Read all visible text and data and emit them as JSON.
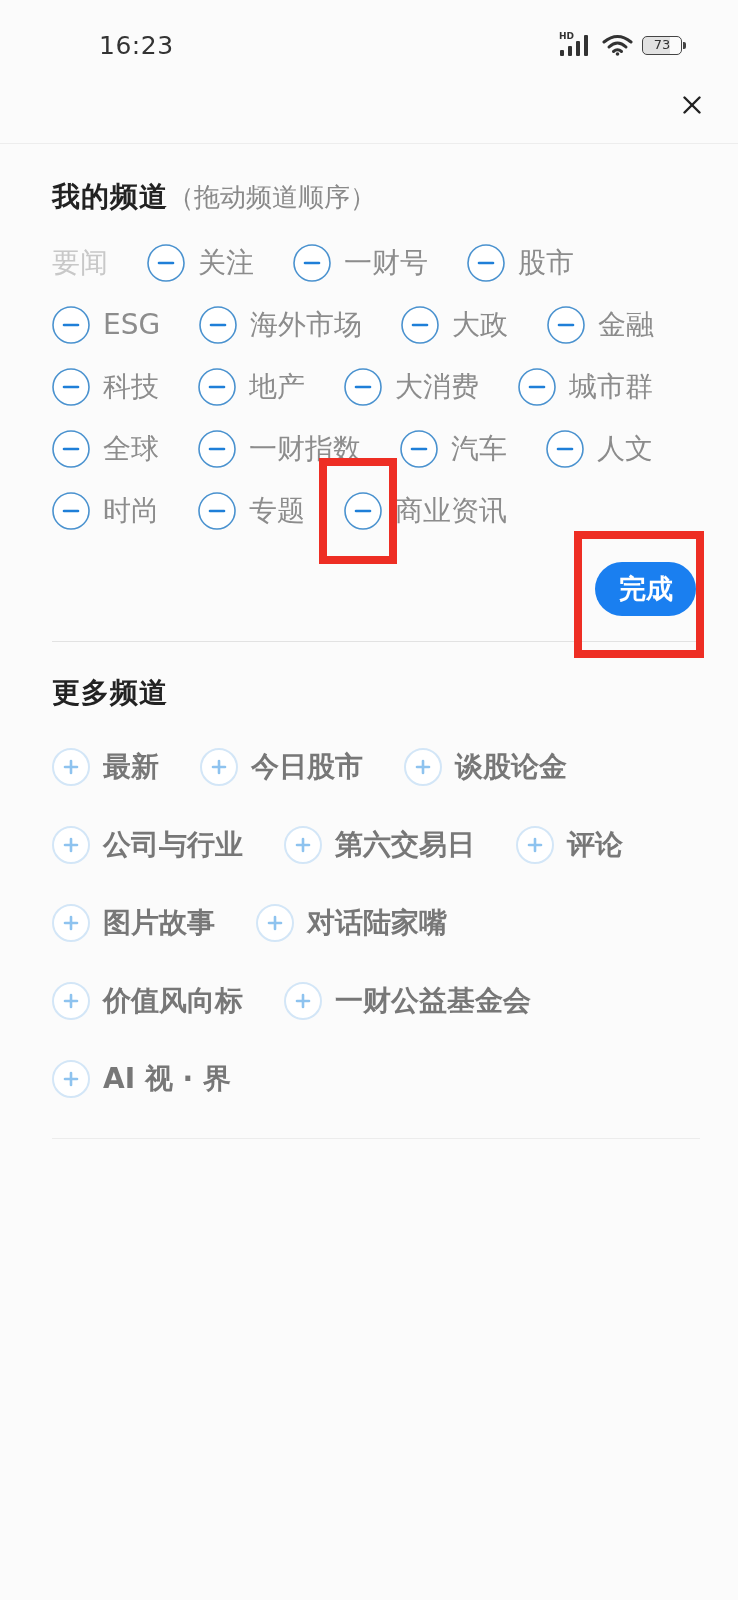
{
  "status_bar": {
    "time": "16:23",
    "network_label": "HD",
    "battery": "73"
  },
  "my_channels": {
    "title": "我的频道",
    "hint": "（拖动频道顺序）",
    "items": [
      {
        "label": "要闻",
        "kind": "fixed",
        "highlighted": false
      },
      {
        "label": "关注",
        "kind": "removable",
        "highlighted": false
      },
      {
        "label": "一财号",
        "kind": "removable",
        "highlighted": false
      },
      {
        "label": "股市",
        "kind": "removable",
        "highlighted": false
      },
      {
        "label": "ESG",
        "kind": "removable",
        "highlighted": false
      },
      {
        "label": "海外市场",
        "kind": "removable",
        "highlighted": false
      },
      {
        "label": "大政",
        "kind": "removable",
        "highlighted": false
      },
      {
        "label": "金融",
        "kind": "removable",
        "highlighted": false
      },
      {
        "label": "科技",
        "kind": "removable",
        "highlighted": false
      },
      {
        "label": "地产",
        "kind": "removable",
        "highlighted": false
      },
      {
        "label": "大消费",
        "kind": "removable",
        "highlighted": false
      },
      {
        "label": "城市群",
        "kind": "removable",
        "highlighted": false
      },
      {
        "label": "全球",
        "kind": "removable",
        "highlighted": false
      },
      {
        "label": "一财指数",
        "kind": "removable",
        "highlighted": false
      },
      {
        "label": "汽车",
        "kind": "removable",
        "highlighted": false
      },
      {
        "label": "人文",
        "kind": "removable",
        "highlighted": false
      },
      {
        "label": "时尚",
        "kind": "removable",
        "highlighted": false
      },
      {
        "label": "专题",
        "kind": "removable",
        "highlighted": false
      },
      {
        "label": "商业资讯",
        "kind": "removable",
        "highlighted": true
      }
    ]
  },
  "done_button": {
    "label": "完成",
    "highlighted": true
  },
  "more_channels": {
    "title": "更多频道",
    "items": [
      "最新",
      "今日股市",
      "谈股论金",
      "公司与行业",
      "第六交易日",
      "评论",
      "图片故事",
      "对话陆家嘴",
      "价值风向标",
      "一财公益基金会",
      "AI 视 · 界"
    ]
  }
}
